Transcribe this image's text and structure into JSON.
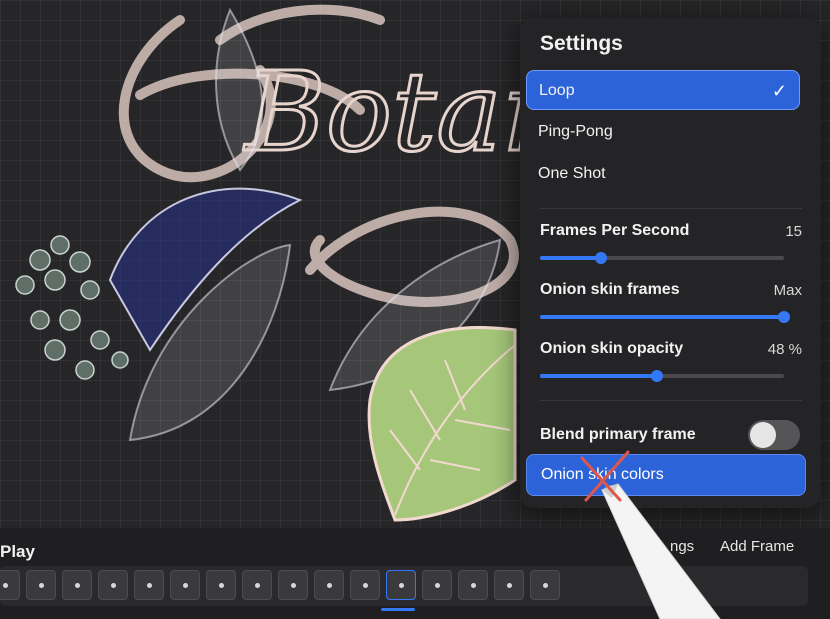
{
  "settings": {
    "title": "Settings",
    "modes": [
      {
        "label": "Loop",
        "selected": true
      },
      {
        "label": "Ping-Pong",
        "selected": false
      },
      {
        "label": "One Shot",
        "selected": false
      }
    ],
    "check_glyph": "✓",
    "fps": {
      "label": "Frames Per Second",
      "value_text": "15",
      "fraction": 0.25
    },
    "onion_frames": {
      "label": "Onion skin frames",
      "value_text": "Max",
      "fraction": 1.0
    },
    "onion_opacity": {
      "label": "Onion skin opacity",
      "value_text": "48 %",
      "fraction": 0.48
    },
    "blend_primary": {
      "label": "Blend primary frame",
      "enabled": false
    },
    "onion_colors_label": "Onion skin colors"
  },
  "timeline": {
    "play_label": "Play",
    "settings_partial": "ngs",
    "add_frame_label": "Add Frame",
    "frame_count": 16,
    "active_frame_index": 11
  },
  "artwork": {
    "text_fragment": "Botan"
  },
  "colors": {
    "accent": "#3478f6",
    "selected_row": "#2c63d9",
    "panel": "#242426",
    "leaf_green": "#a6c77a"
  },
  "icons": [
    "checkmark-icon",
    "apple-pencil-icon"
  ]
}
